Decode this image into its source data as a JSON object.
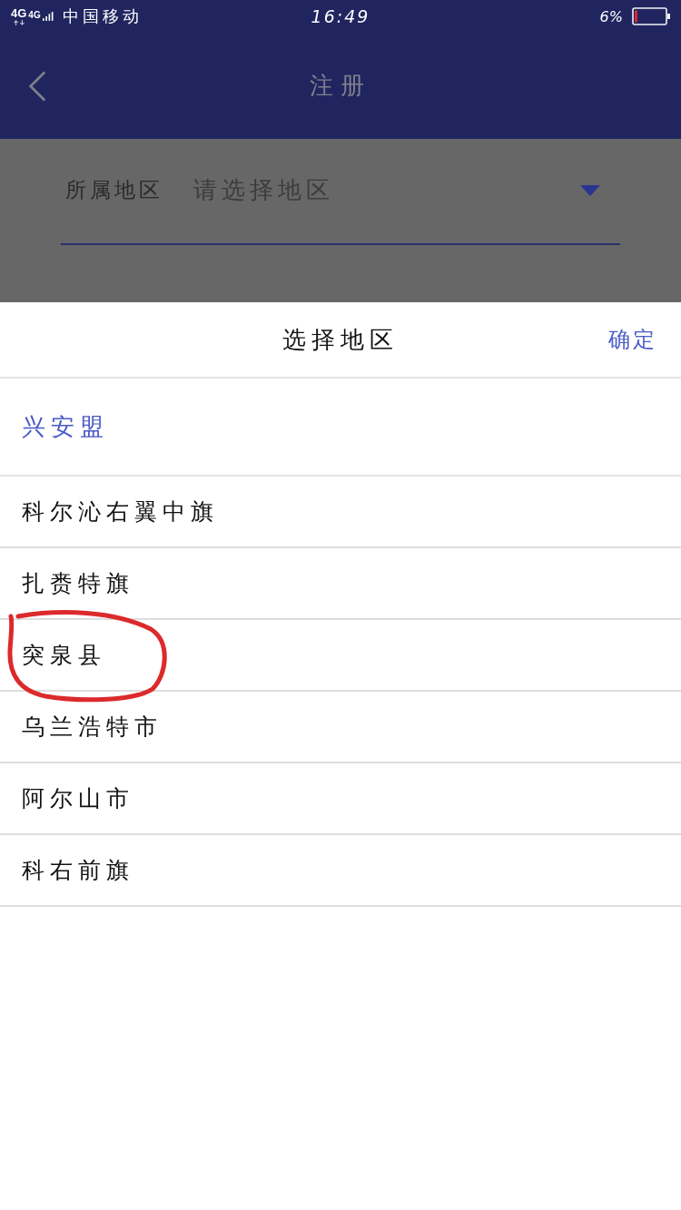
{
  "status_bar": {
    "network_labels": [
      "4G",
      "4G"
    ],
    "carrier": "中国移动",
    "time": "16:49",
    "battery_text": "6%"
  },
  "nav_bar": {
    "title": "注册"
  },
  "form": {
    "fields": [
      {
        "kind": "select",
        "label": "所属地区",
        "placeholder": "请选择地区"
      }
    ]
  },
  "region_sheet": {
    "title": "选择地区",
    "confirm": "确定",
    "tabs": [
      {
        "label": "兴安盟",
        "selected": true
      }
    ],
    "options": [
      {
        "label": "科尔沁右翼中旗",
        "selected": false,
        "circled": false
      },
      {
        "label": "扎赉特旗",
        "selected": false,
        "circled": false
      },
      {
        "label": "突泉县",
        "selected": false,
        "circled": true
      },
      {
        "label": "乌兰浩特市",
        "selected": false,
        "circled": false
      },
      {
        "label": "阿尔山市",
        "selected": false,
        "circled": false
      },
      {
        "label": "科右前旗",
        "selected": false,
        "circled": false
      }
    ]
  }
}
